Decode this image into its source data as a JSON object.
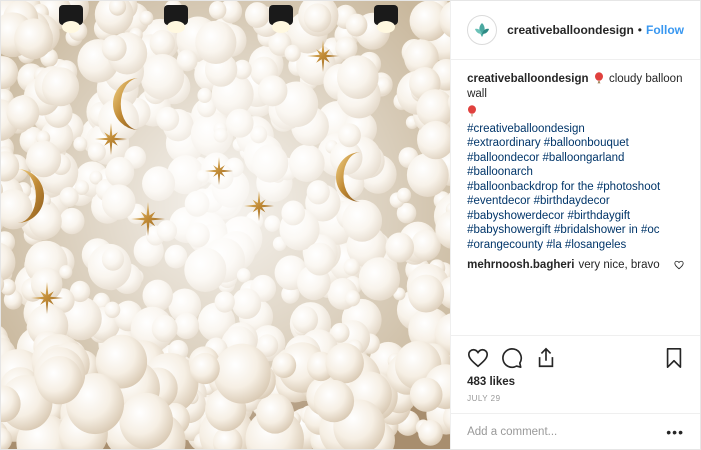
{
  "post": {
    "username": "creativeballoondesign",
    "separator": "•",
    "follow_label": "Follow",
    "image_description": "White cloud balloon wall with gold stars and moons"
  },
  "caption": {
    "username": "creativeballoondesign",
    "text": "cloudy balloon wall",
    "lines": [
      "#creativeballoondesign",
      "#extraordinary #balloonbouquet",
      "#balloondecor #balloongarland #balloonarch",
      "#balloonbackdrop for the #photoshoot",
      "#eventdecor #birthdaydecor",
      "#babyshowerdecor #birthdaygift",
      "#babyshowergift #bridalshower in #oc",
      "#orangecounty #la #losangeles"
    ]
  },
  "comments": [
    {
      "username": "mehrnoosh.bagheri",
      "text": "very nice, bravo"
    }
  ],
  "stats": {
    "likes": "483 likes",
    "date": "JULY 29"
  },
  "add_comment": {
    "placeholder": "Add a comment...",
    "more": "•••"
  },
  "icons": {
    "avatar": "leaf-logo-icon",
    "emoji": "balloon-icon",
    "like": "heart-icon",
    "comment": "comment-bubble-icon",
    "share": "share-icon",
    "save": "bookmark-icon",
    "comment_like": "small-heart-icon"
  },
  "colors": {
    "link": "#003569",
    "follow": "#3897f0",
    "balloon_emoji": "#e0413e"
  }
}
